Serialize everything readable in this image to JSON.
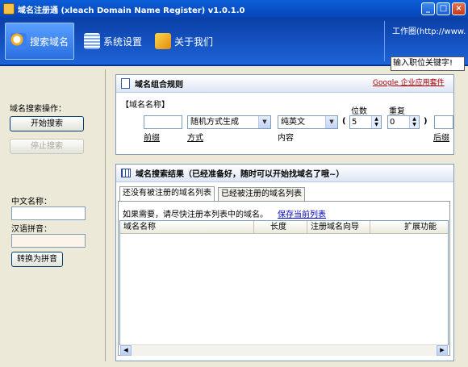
{
  "window": {
    "title": "域名注册通 (xleach Domain Name Register) v1.0.1.0",
    "controls": {
      "minimize": "_",
      "maximize": "□",
      "close": "×"
    }
  },
  "toolbar": {
    "items": [
      {
        "label": "搜索域名",
        "icon": "search-domain-icon"
      },
      {
        "label": "系统设置",
        "icon": "settings-icon"
      },
      {
        "label": "关于我们",
        "icon": "home-icon"
      }
    ],
    "workcircle_label": "工作圈(http://www.",
    "workcircle_input": "输入职位关键字!"
  },
  "left": {
    "search_ops_label": "域名搜索操作：",
    "start_button": "开始搜索",
    "stop_button": "停止搜索",
    "chinese_name_label": "中文名称：",
    "chinese_name_value": "",
    "pinyin_label": "汉语拼音：",
    "pinyin_value": "",
    "convert_button": "转换为拼音"
  },
  "rules": {
    "title": "域名组合规则",
    "ad_link": "Google 企业应用套件",
    "name_label": "【域名名称】",
    "prefix_value": "",
    "prefix_label": "前缀",
    "method_value": "随机方式生成",
    "method_label": "方式",
    "content_value": "纯英文",
    "content_label": "内容",
    "open_paren": "(",
    "close_paren": ")",
    "digits_label": "位数",
    "digits_value": "5",
    "repeat_label": "重复",
    "repeat_value": "0",
    "suffix_value": "",
    "suffix_label": "后缀"
  },
  "results": {
    "title": "域名搜索结果（已经准备好，随时可以开始找域名了哦~）",
    "tabs": [
      {
        "label": "还没有被注册的域名列表",
        "active": true
      },
      {
        "label": "已经被注册的域名列表",
        "active": false
      }
    ],
    "hint": "如果需要，请尽快注册本列表中的域名。",
    "save_link": "保存当前列表",
    "columns": [
      "域名名称",
      "长度",
      "注册域名向导",
      "扩展功能"
    ],
    "rows": []
  }
}
